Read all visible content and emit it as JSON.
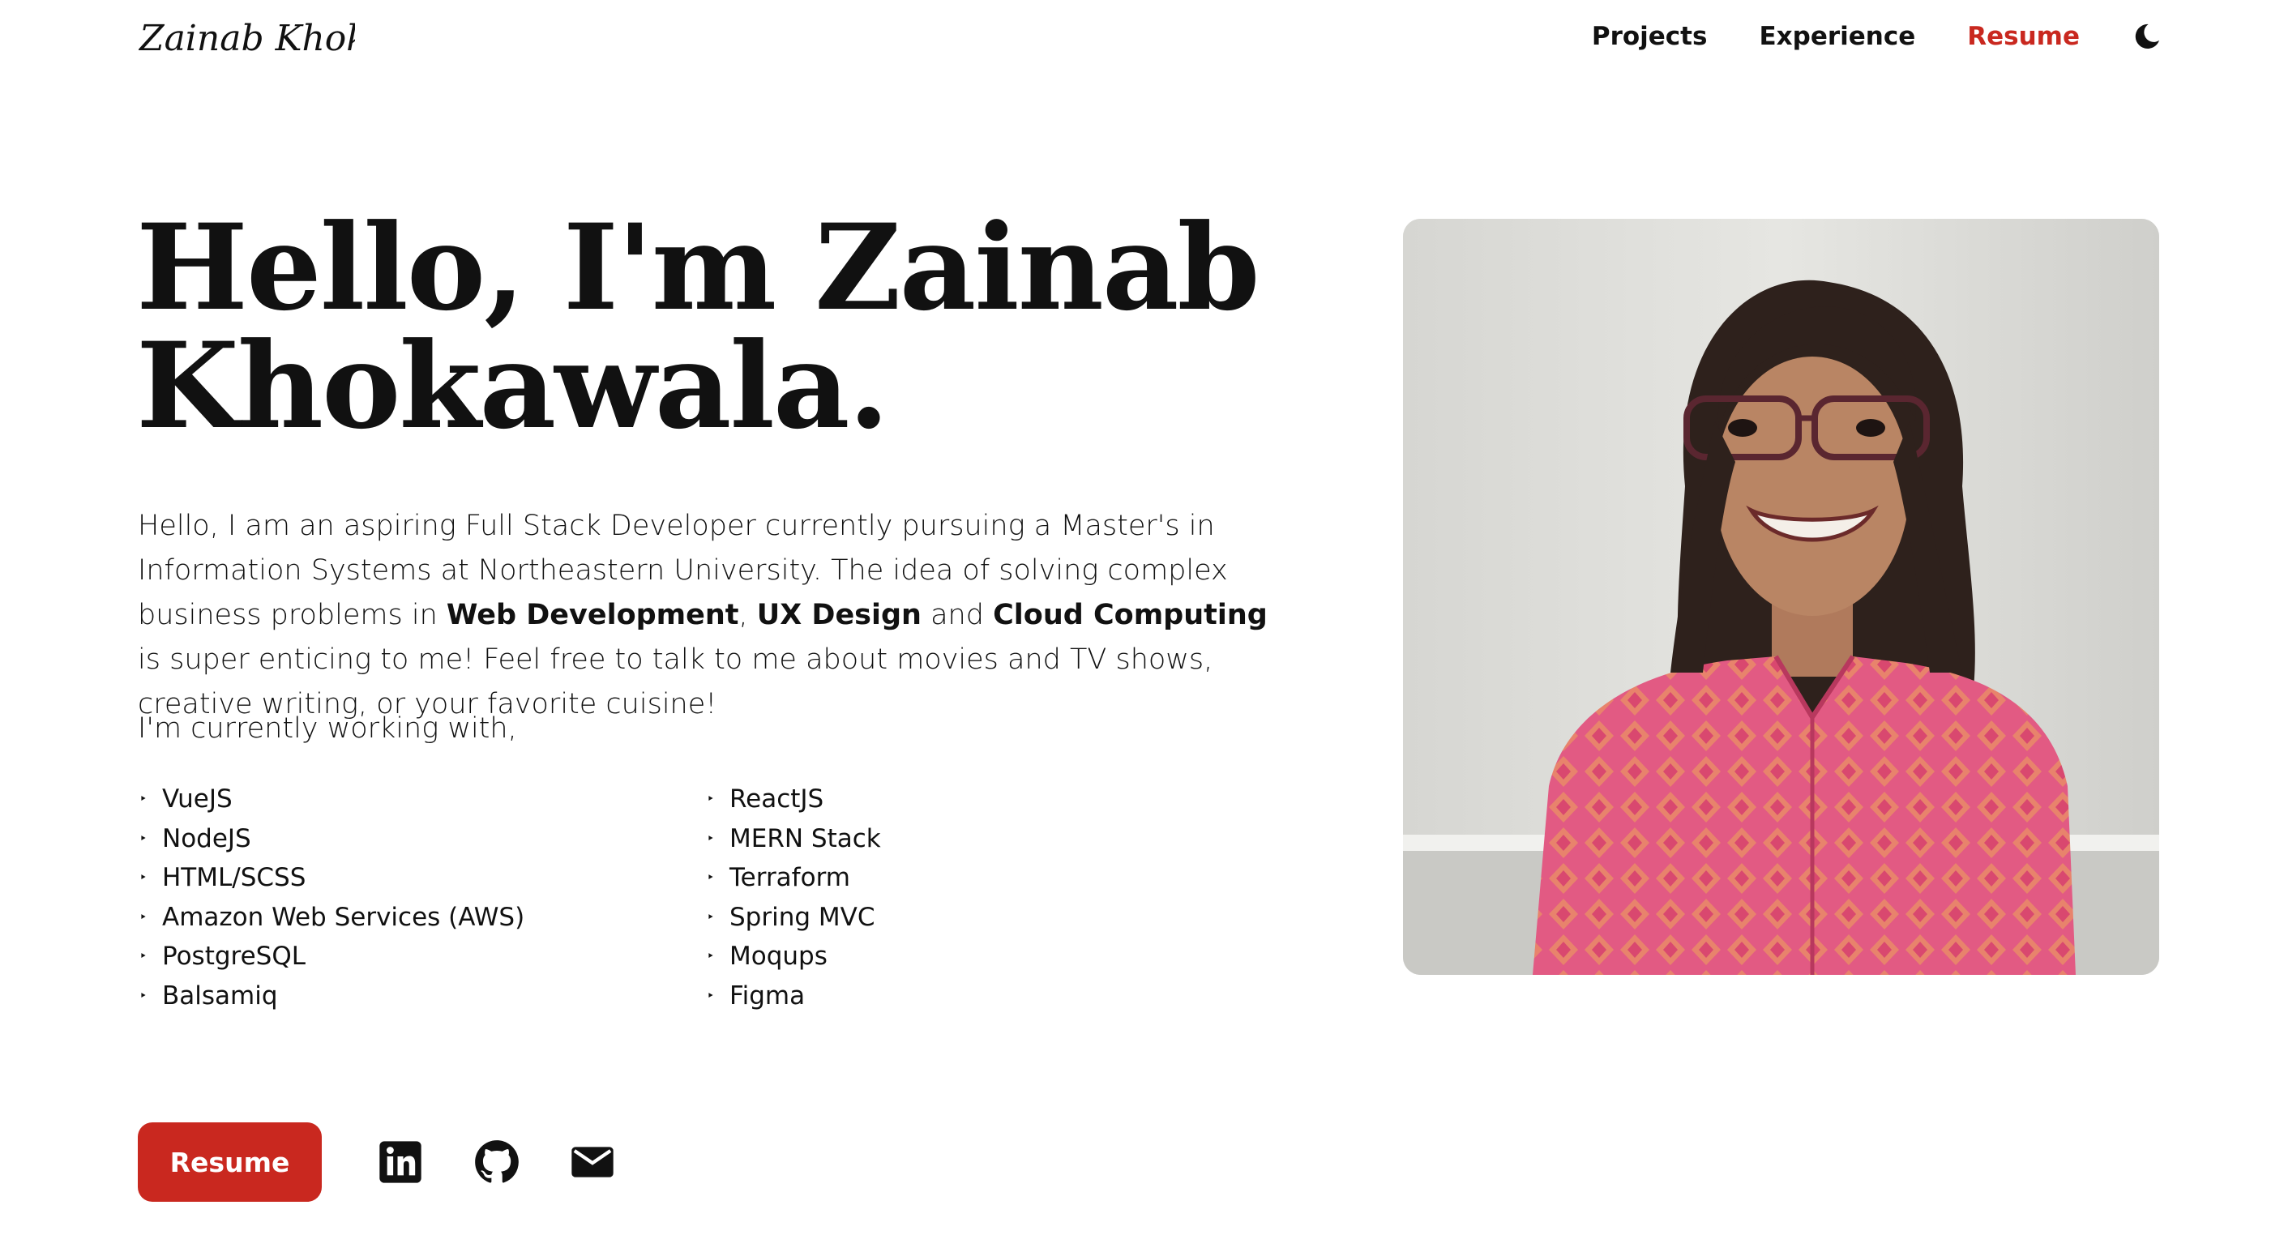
{
  "header": {
    "logo_text": "Zainab Khokawala",
    "nav": [
      {
        "label": "Projects"
      },
      {
        "label": "Experience"
      },
      {
        "label": "Resume"
      }
    ],
    "theme_toggle_icon": "moon-icon"
  },
  "hero": {
    "title_line1": "Hello, I'm Zainab",
    "title_line2": "Khokawala.",
    "intro": {
      "part1": "Hello, I am an aspiring Full Stack Developer currently pursuing a Master's in Information Systems at Northeastern University. The idea of solving complex business problems in ",
      "bold1": "Web Development",
      "sep1": ", ",
      "bold2": "UX Design",
      "sep2": " and ",
      "bold3": "Cloud Computing",
      "part2": " is super enticing to me! Feel free to talk to me about movies and TV shows, creative writing, or your favorite cuisine!"
    },
    "working_with": "I'm currently working with,",
    "bullet": "‣",
    "skills_col1": [
      "VueJS",
      "NodeJS",
      "HTML/SCSS",
      "Amazon Web Services (AWS)",
      "PostgreSQL",
      "Balsamiq"
    ],
    "skills_col2": [
      "ReactJS",
      "MERN Stack",
      "Terraform",
      "Spring MVC",
      "Moqups",
      "Figma"
    ]
  },
  "actions": {
    "resume_button": "Resume",
    "icons": [
      "linkedin-icon",
      "github-icon",
      "email-icon"
    ]
  },
  "colors": {
    "accent": "#c9281f",
    "text": "#111111",
    "background": "#ffffff"
  }
}
